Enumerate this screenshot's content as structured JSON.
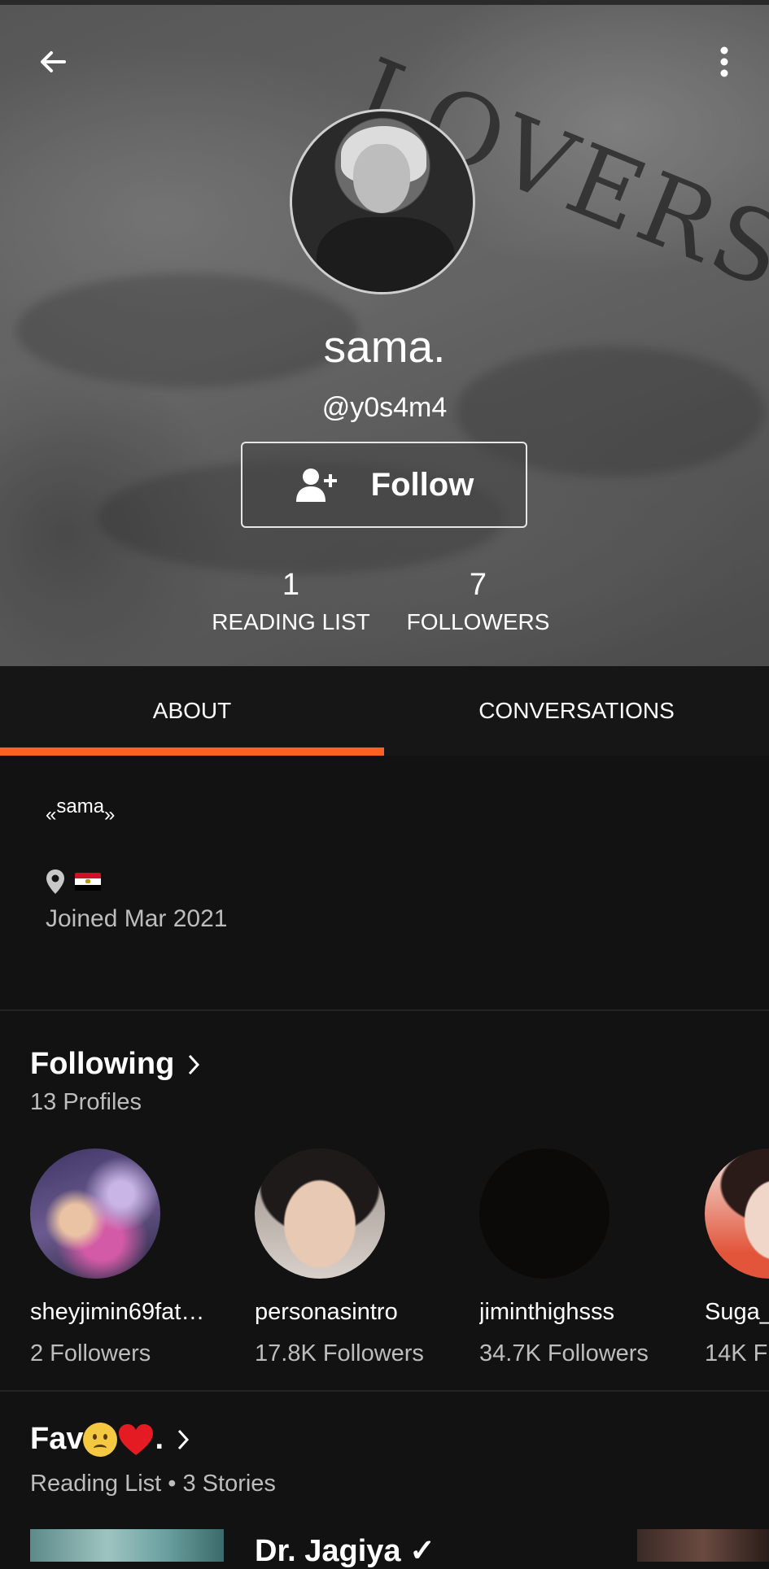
{
  "profile": {
    "display_name": "sama.",
    "username": "@y0s4m4",
    "follow_label": "Follow",
    "background_text": "LOVERS",
    "stats": {
      "reading_list_count": "1",
      "reading_list_label": "READING LIST",
      "followers_count": "7",
      "followers_label": "FOLLOWERS"
    }
  },
  "tabs": {
    "about": "ABOUT",
    "conversations": "CONVERSATIONS",
    "active": "about"
  },
  "about": {
    "quote_open": "«",
    "description": "sama",
    "quote_close": "»",
    "location_icon": "location-pin-icon",
    "location_flag": "egypt-flag",
    "joined": "Joined Mar 2021"
  },
  "following": {
    "title": "Following",
    "subtitle": "13 Profiles",
    "profiles": [
      {
        "name": "sheyjimin69fat…",
        "followers": "2 Followers"
      },
      {
        "name": "personasintro",
        "followers": "17.8K Followers"
      },
      {
        "name": "jiminthighsss",
        "followers": "34.7K Followers"
      },
      {
        "name": "Suga_",
        "followers": "14K F"
      }
    ]
  },
  "reading_list": {
    "title": "Fav",
    "title_suffix": ".",
    "subtitle": "Reading List • 3 Stories",
    "stories": [
      {
        "title": "Dr. Jagiya ✓"
      }
    ]
  },
  "colors": {
    "accent": "#ff6122",
    "background": "#121212",
    "tab_background": "#161616",
    "secondary_text": "#bdbdbd"
  },
  "icons": {
    "back": "arrow-left-icon",
    "more": "more-vertical-icon",
    "follow": "add-user-icon",
    "chevron": "chevron-right-icon"
  }
}
